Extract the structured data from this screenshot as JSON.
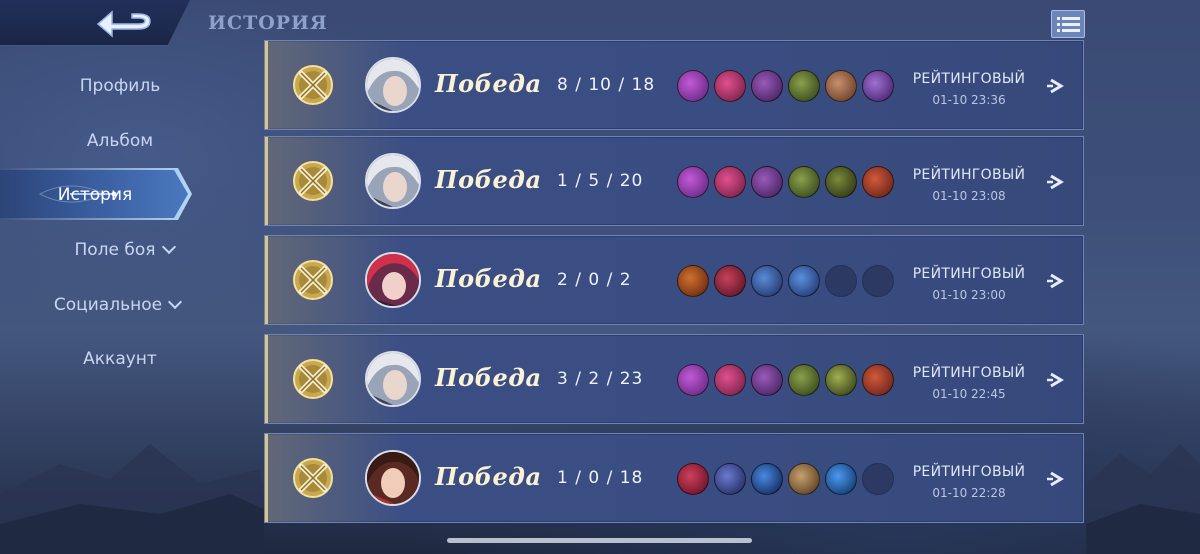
{
  "header": {
    "title": "ИСТОРИЯ",
    "back_icon": "back-arrow-icon",
    "list_icon": "list-icon"
  },
  "sidebar": {
    "items": [
      {
        "label": "Профиль",
        "active": false,
        "expandable": false
      },
      {
        "label": "Альбом",
        "active": false,
        "expandable": false
      },
      {
        "label": "История",
        "active": true,
        "expandable": false
      },
      {
        "label": "Поле боя",
        "active": false,
        "expandable": true
      },
      {
        "label": "Социальное",
        "active": false,
        "expandable": true
      },
      {
        "label": "Аккаунт",
        "active": false,
        "expandable": false
      }
    ]
  },
  "matches": [
    {
      "result": "Победа",
      "kda": "8 / 10 / 18",
      "mode": "РЕЙТИНГОВЫЙ",
      "time": "01-10 23:36",
      "hero": "hero-silver-hair",
      "items": [
        "#8a3fb0",
        "#b0347a",
        "#6b3a8e",
        "#4f6a2a",
        "#8e5a3a",
        "#6a3aa0"
      ]
    },
    {
      "result": "Победа",
      "kda": "1 / 5 / 20",
      "mode": "РЕЙТИНГОВЫЙ",
      "time": "01-10 23:08",
      "hero": "hero-silver-hair",
      "items": [
        "#8a3fb0",
        "#b0347a",
        "#6b3a8e",
        "#4f6a2a",
        "#3f4a1e",
        "#8a2a2a"
      ]
    },
    {
      "result": "Победа",
      "kda": "2 / 0 / 2",
      "mode": "РЕЙТИНГОВЫЙ",
      "time": "01-10 23:00",
      "hero": "hero-red-hair",
      "items": [
        "#9a3a20",
        "#a02a3a",
        "#2a4a8a",
        "#2a4a9a",
        "",
        ""
      ]
    },
    {
      "result": "Победа",
      "kda": "3 / 2 / 23",
      "mode": "РЕЙТИНГОВЫЙ",
      "time": "01-10 22:45",
      "hero": "hero-silver-hair",
      "items": [
        "#8a3fb0",
        "#b0347a",
        "#6b3a8e",
        "#4f6a2a",
        "#5a6a2a",
        "#8a2a2a"
      ]
    },
    {
      "result": "Победа",
      "kda": "1 / 0 / 18",
      "mode": "РЕЙТИНГОВЫЙ",
      "time": "01-10 22:28",
      "hero": "hero-dark-hair",
      "items": [
        "#9a2030",
        "#3a4a9a",
        "#2a5aaa",
        "#8a6a3a",
        "#2a6ab0",
        ""
      ]
    }
  ],
  "colors": {
    "card_bg": "#3a4d82",
    "card_border": "#6d83b9",
    "win_gold": "#e2c46a",
    "active_tab": "#4a78bf"
  }
}
